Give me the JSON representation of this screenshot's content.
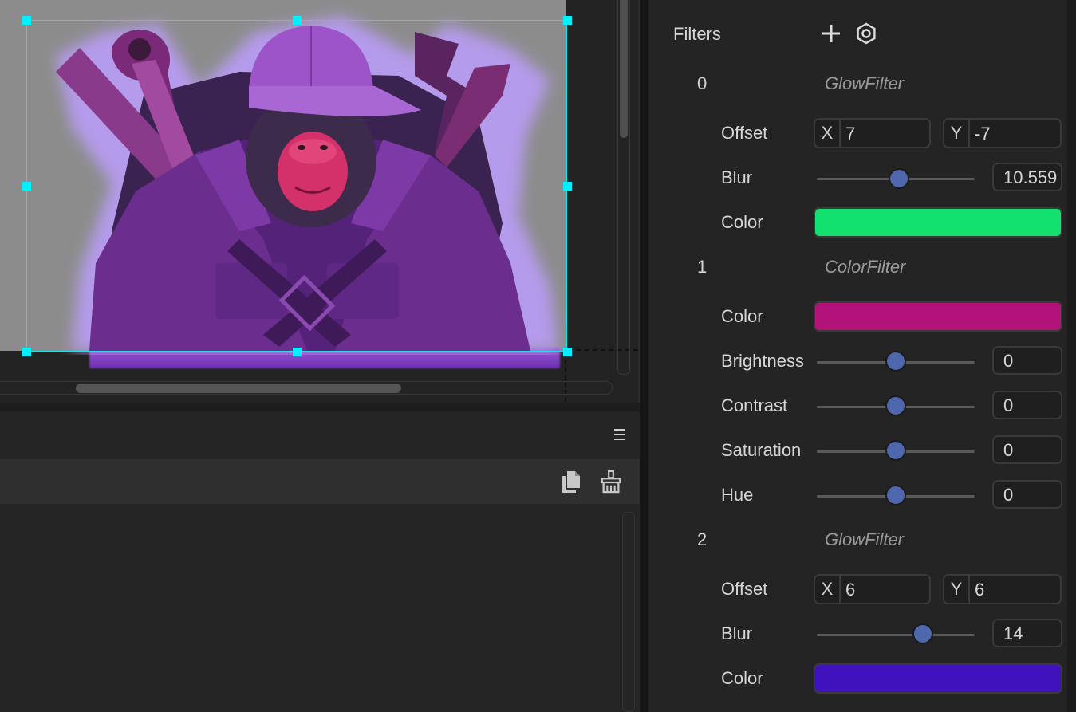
{
  "inspector": {
    "section_title": "Filters",
    "add_icon": "plus-icon",
    "settings_icon": "hexagon-gear-icon",
    "filters": [
      {
        "index": "0",
        "type": "GlowFilter",
        "offset": {
          "label": "Offset",
          "x_axis": "X",
          "x": "7",
          "y_axis": "Y",
          "y": "-7"
        },
        "blur": {
          "label": "Blur",
          "value": "10.559",
          "level": 0.52
        },
        "color": {
          "label": "Color",
          "hex": "#12e06f"
        }
      },
      {
        "index": "1",
        "type": "ColorFilter",
        "color": {
          "label": "Color",
          "hex": "#b2127a"
        },
        "brightness": {
          "label": "Brightness",
          "value": "0",
          "level": 0.5
        },
        "contrast": {
          "label": "Contrast",
          "value": "0",
          "level": 0.5
        },
        "saturation": {
          "label": "Saturation",
          "value": "0",
          "level": 0.5
        },
        "hue": {
          "label": "Hue",
          "value": "0",
          "level": 0.5
        }
      },
      {
        "index": "2",
        "type": "GlowFilter",
        "offset": {
          "label": "Offset",
          "x_axis": "X",
          "x": "6",
          "y_axis": "Y",
          "y": "6"
        },
        "blur": {
          "label": "Blur",
          "value": "14",
          "level": 0.67
        },
        "color": {
          "label": "Color",
          "hex": "#4012bd"
        }
      }
    ]
  },
  "console": {
    "menu_icon": "hamburger-menu-icon",
    "copy_icon": "copy-icon",
    "clear_icon": "clear-broom-icon"
  },
  "viewport": {
    "sprite_icon": "gorilla-mechanic-sprite",
    "selection_color": "#19e3e8"
  }
}
